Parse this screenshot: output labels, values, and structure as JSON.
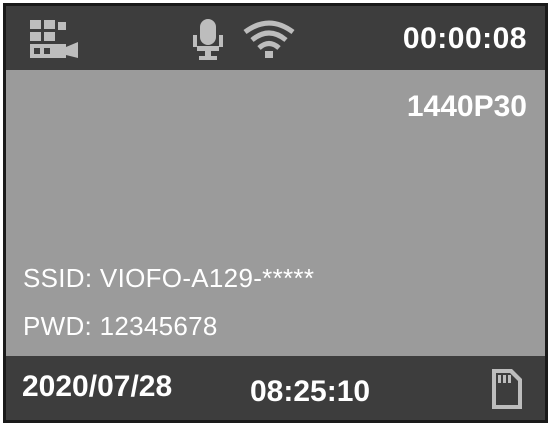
{
  "status_bar": {
    "icons": [
      "video-camera-icon",
      "microphone-icon",
      "wifi-icon"
    ],
    "recording_timer": "00:00:08"
  },
  "main": {
    "resolution": "1440P30",
    "ssid": "SSID: VIOFO-A129-*****",
    "password": "PWD: 12345678"
  },
  "footer": {
    "date": "2020/07/28",
    "time": "08:25:10",
    "icons": [
      "sd-card-icon"
    ]
  },
  "colors": {
    "bar_background": "#3d3d3d",
    "screen_background": "#9b9b9b",
    "text": "#ffffff",
    "icon": "#bdbdbd"
  }
}
